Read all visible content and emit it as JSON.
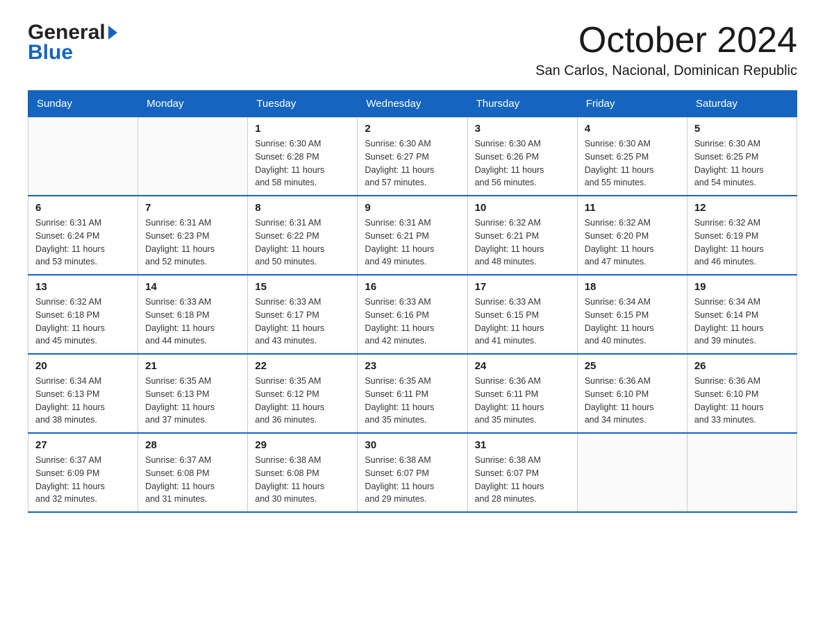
{
  "logo": {
    "general": "General",
    "blue": "Blue"
  },
  "title": {
    "month": "October 2024",
    "location": "San Carlos, Nacional, Dominican Republic"
  },
  "weekdays": [
    "Sunday",
    "Monday",
    "Tuesday",
    "Wednesday",
    "Thursday",
    "Friday",
    "Saturday"
  ],
  "weeks": [
    [
      {
        "day": "",
        "info": ""
      },
      {
        "day": "",
        "info": ""
      },
      {
        "day": "1",
        "info": "Sunrise: 6:30 AM\nSunset: 6:28 PM\nDaylight: 11 hours\nand 58 minutes."
      },
      {
        "day": "2",
        "info": "Sunrise: 6:30 AM\nSunset: 6:27 PM\nDaylight: 11 hours\nand 57 minutes."
      },
      {
        "day": "3",
        "info": "Sunrise: 6:30 AM\nSunset: 6:26 PM\nDaylight: 11 hours\nand 56 minutes."
      },
      {
        "day": "4",
        "info": "Sunrise: 6:30 AM\nSunset: 6:25 PM\nDaylight: 11 hours\nand 55 minutes."
      },
      {
        "day": "5",
        "info": "Sunrise: 6:30 AM\nSunset: 6:25 PM\nDaylight: 11 hours\nand 54 minutes."
      }
    ],
    [
      {
        "day": "6",
        "info": "Sunrise: 6:31 AM\nSunset: 6:24 PM\nDaylight: 11 hours\nand 53 minutes."
      },
      {
        "day": "7",
        "info": "Sunrise: 6:31 AM\nSunset: 6:23 PM\nDaylight: 11 hours\nand 52 minutes."
      },
      {
        "day": "8",
        "info": "Sunrise: 6:31 AM\nSunset: 6:22 PM\nDaylight: 11 hours\nand 50 minutes."
      },
      {
        "day": "9",
        "info": "Sunrise: 6:31 AM\nSunset: 6:21 PM\nDaylight: 11 hours\nand 49 minutes."
      },
      {
        "day": "10",
        "info": "Sunrise: 6:32 AM\nSunset: 6:21 PM\nDaylight: 11 hours\nand 48 minutes."
      },
      {
        "day": "11",
        "info": "Sunrise: 6:32 AM\nSunset: 6:20 PM\nDaylight: 11 hours\nand 47 minutes."
      },
      {
        "day": "12",
        "info": "Sunrise: 6:32 AM\nSunset: 6:19 PM\nDaylight: 11 hours\nand 46 minutes."
      }
    ],
    [
      {
        "day": "13",
        "info": "Sunrise: 6:32 AM\nSunset: 6:18 PM\nDaylight: 11 hours\nand 45 minutes."
      },
      {
        "day": "14",
        "info": "Sunrise: 6:33 AM\nSunset: 6:18 PM\nDaylight: 11 hours\nand 44 minutes."
      },
      {
        "day": "15",
        "info": "Sunrise: 6:33 AM\nSunset: 6:17 PM\nDaylight: 11 hours\nand 43 minutes."
      },
      {
        "day": "16",
        "info": "Sunrise: 6:33 AM\nSunset: 6:16 PM\nDaylight: 11 hours\nand 42 minutes."
      },
      {
        "day": "17",
        "info": "Sunrise: 6:33 AM\nSunset: 6:15 PM\nDaylight: 11 hours\nand 41 minutes."
      },
      {
        "day": "18",
        "info": "Sunrise: 6:34 AM\nSunset: 6:15 PM\nDaylight: 11 hours\nand 40 minutes."
      },
      {
        "day": "19",
        "info": "Sunrise: 6:34 AM\nSunset: 6:14 PM\nDaylight: 11 hours\nand 39 minutes."
      }
    ],
    [
      {
        "day": "20",
        "info": "Sunrise: 6:34 AM\nSunset: 6:13 PM\nDaylight: 11 hours\nand 38 minutes."
      },
      {
        "day": "21",
        "info": "Sunrise: 6:35 AM\nSunset: 6:13 PM\nDaylight: 11 hours\nand 37 minutes."
      },
      {
        "day": "22",
        "info": "Sunrise: 6:35 AM\nSunset: 6:12 PM\nDaylight: 11 hours\nand 36 minutes."
      },
      {
        "day": "23",
        "info": "Sunrise: 6:35 AM\nSunset: 6:11 PM\nDaylight: 11 hours\nand 35 minutes."
      },
      {
        "day": "24",
        "info": "Sunrise: 6:36 AM\nSunset: 6:11 PM\nDaylight: 11 hours\nand 35 minutes."
      },
      {
        "day": "25",
        "info": "Sunrise: 6:36 AM\nSunset: 6:10 PM\nDaylight: 11 hours\nand 34 minutes."
      },
      {
        "day": "26",
        "info": "Sunrise: 6:36 AM\nSunset: 6:10 PM\nDaylight: 11 hours\nand 33 minutes."
      }
    ],
    [
      {
        "day": "27",
        "info": "Sunrise: 6:37 AM\nSunset: 6:09 PM\nDaylight: 11 hours\nand 32 minutes."
      },
      {
        "day": "28",
        "info": "Sunrise: 6:37 AM\nSunset: 6:08 PM\nDaylight: 11 hours\nand 31 minutes."
      },
      {
        "day": "29",
        "info": "Sunrise: 6:38 AM\nSunset: 6:08 PM\nDaylight: 11 hours\nand 30 minutes."
      },
      {
        "day": "30",
        "info": "Sunrise: 6:38 AM\nSunset: 6:07 PM\nDaylight: 11 hours\nand 29 minutes."
      },
      {
        "day": "31",
        "info": "Sunrise: 6:38 AM\nSunset: 6:07 PM\nDaylight: 11 hours\nand 28 minutes."
      },
      {
        "day": "",
        "info": ""
      },
      {
        "day": "",
        "info": ""
      }
    ]
  ]
}
